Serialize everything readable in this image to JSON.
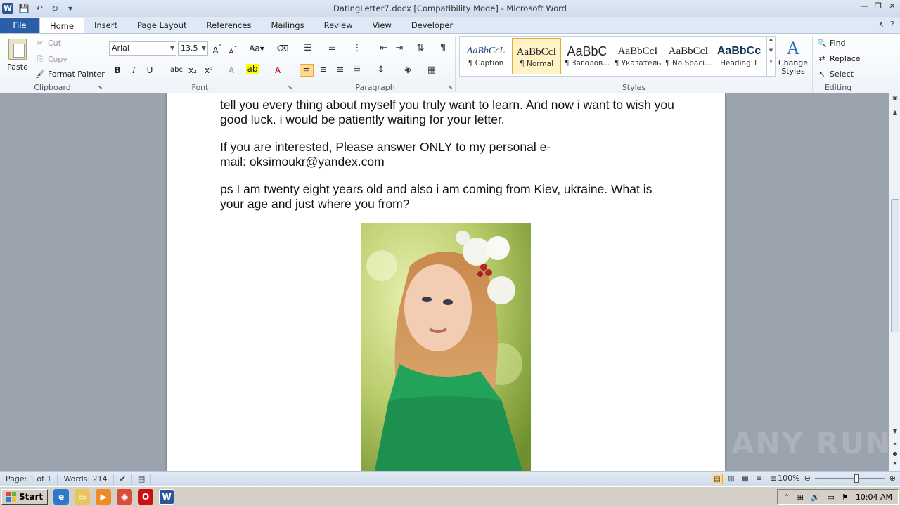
{
  "window": {
    "title": "DatingLetter7.docx [Compatibility Mode]  -  Microsoft Word",
    "app_letter": "W"
  },
  "tabs": [
    "File",
    "Home",
    "Insert",
    "Page Layout",
    "References",
    "Mailings",
    "Review",
    "View",
    "Developer"
  ],
  "active_tab": "Home",
  "ribbon": {
    "clipboard": {
      "label": "Clipboard",
      "paste": "Paste",
      "cut": "Cut",
      "copy": "Copy",
      "format_painter": "Format Painter"
    },
    "font": {
      "label": "Font",
      "family": "Arial",
      "size": "13.5"
    },
    "paragraph": {
      "label": "Paragraph"
    },
    "styles": {
      "label": "Styles",
      "items": [
        {
          "sample": "AaBbCcL",
          "name": "¶ Caption"
        },
        {
          "sample": "AaBbCcI",
          "name": "¶ Normal"
        },
        {
          "sample": "AaBbC",
          "name": "¶ Заголов..."
        },
        {
          "sample": "AaBbCcI",
          "name": "¶ Указатель"
        },
        {
          "sample": "AaBbCcI",
          "name": "¶ No Spaci..."
        },
        {
          "sample": "AaBbCс",
          "name": "Heading 1"
        }
      ],
      "selected_index": 1,
      "change_styles": "Change Styles"
    },
    "editing": {
      "label": "Editing",
      "find": "Find",
      "replace": "Replace",
      "select": "Select"
    }
  },
  "document": {
    "para1": "tell you every thing about myself you truly want to learn. And now i want to wish you good luck. i would be patiently waiting for your letter.",
    "para2_text": "If you are interested, Please answer ONLY to my personal e-mail: ",
    "para2_line1": "If you are interested, Please answer ONLY to my personal e-",
    "para2_line2_prefix": "mail: ",
    "email": "oksimoukr@yandex.com",
    "para3": "ps I am twenty eight years old and also i am coming from Kiev, ukraine. What is your age and just where you from?"
  },
  "status": {
    "page": "Page: 1 of 1",
    "words": "Words: 214",
    "zoom": "100%"
  },
  "taskbar": {
    "start": "Start",
    "time": "10:04 AM"
  },
  "watermark": "ANY RUN",
  "colors": {
    "file_tab": "#2a5ea8",
    "selected_style": "#fff3c6",
    "accent_highlight": "#fddc8f"
  }
}
